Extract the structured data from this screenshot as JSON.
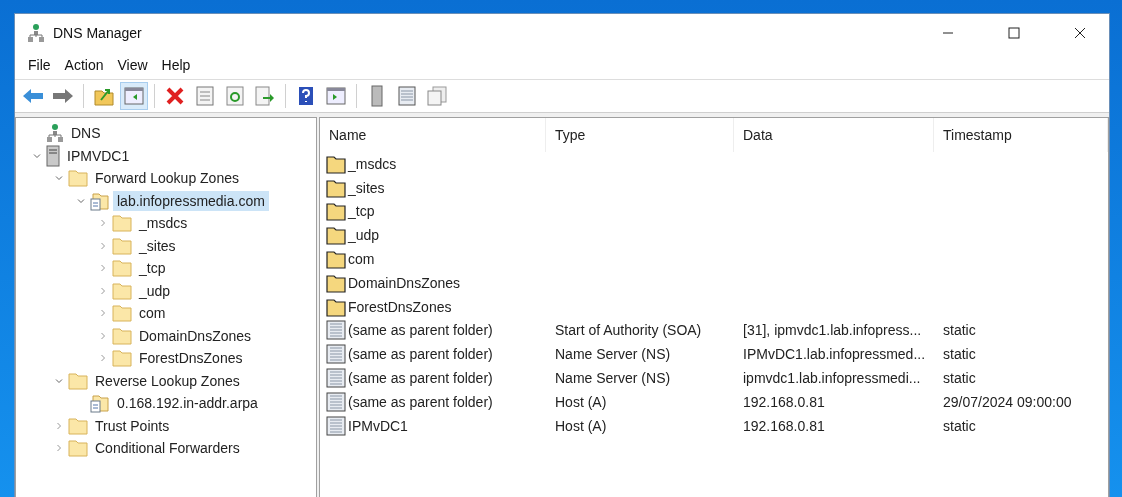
{
  "window": {
    "title": "DNS Manager"
  },
  "menu": [
    "File",
    "Action",
    "View",
    "Help"
  ],
  "toolbar": [
    {
      "kind": "back",
      "pressed": false
    },
    {
      "kind": "forward",
      "pressed": false
    },
    {
      "kind": "separator"
    },
    {
      "kind": "up",
      "pressed": false
    },
    {
      "kind": "console-tree",
      "pressed": true
    },
    {
      "kind": "separator"
    },
    {
      "kind": "delete",
      "pressed": false
    },
    {
      "kind": "properties",
      "pressed": false
    },
    {
      "kind": "refresh",
      "pressed": false
    },
    {
      "kind": "export",
      "pressed": false
    },
    {
      "kind": "separator"
    },
    {
      "kind": "help",
      "pressed": false
    },
    {
      "kind": "action-pane",
      "pressed": false
    },
    {
      "kind": "separator"
    },
    {
      "kind": "server",
      "pressed": false
    },
    {
      "kind": "list",
      "pressed": false
    },
    {
      "kind": "copy",
      "pressed": false
    }
  ],
  "tree": [
    {
      "label": "DNS",
      "kind": "dns",
      "selected": false,
      "children": [
        {
          "label": "IPMVDC1",
          "kind": "server",
          "selected": false,
          "expanded": true,
          "children": [
            {
              "label": "Forward Lookup Zones",
              "kind": "folder",
              "selected": false,
              "expanded": true,
              "children": [
                {
                  "label": "lab.infopressmedia.com",
                  "kind": "zone",
                  "selected": true,
                  "expanded": true,
                  "children": [
                    {
                      "label": "_msdcs",
                      "kind": "folder",
                      "selected": false,
                      "expanded": false
                    },
                    {
                      "label": "_sites",
                      "kind": "folder",
                      "selected": false,
                      "expanded": false
                    },
                    {
                      "label": "_tcp",
                      "kind": "folder",
                      "selected": false,
                      "expanded": false
                    },
                    {
                      "label": "_udp",
                      "kind": "folder",
                      "selected": false,
                      "expanded": false
                    },
                    {
                      "label": "com",
                      "kind": "folder",
                      "selected": false,
                      "expanded": false
                    },
                    {
                      "label": "DomainDnsZones",
                      "kind": "folder",
                      "selected": false,
                      "expanded": false
                    },
                    {
                      "label": "ForestDnsZones",
                      "kind": "folder",
                      "selected": false,
                      "expanded": false
                    }
                  ]
                }
              ]
            },
            {
              "label": "Reverse Lookup Zones",
              "kind": "folder",
              "selected": false,
              "expanded": true,
              "children": [
                {
                  "label": "0.168.192.in-addr.arpa",
                  "kind": "zone",
                  "selected": false
                }
              ]
            },
            {
              "label": "Trust Points",
              "kind": "folder",
              "selected": false,
              "expanded": false
            },
            {
              "label": "Conditional Forwarders",
              "kind": "folder",
              "selected": false,
              "expanded": false
            }
          ]
        }
      ]
    }
  ],
  "table": {
    "columns": [
      "Name",
      "Type",
      "Data",
      "Timestamp"
    ],
    "rows": [
      {
        "kind": "folder",
        "name": "_msdcs"
      },
      {
        "kind": "folder",
        "name": "_sites"
      },
      {
        "kind": "folder",
        "name": "_tcp"
      },
      {
        "kind": "folder",
        "name": "_udp"
      },
      {
        "kind": "folder",
        "name": "com"
      },
      {
        "kind": "folder",
        "name": "DomainDnsZones"
      },
      {
        "kind": "folder",
        "name": "ForestDnsZones"
      },
      {
        "kind": "record",
        "name": "(same as parent folder)",
        "type": "Start of Authority (SOA)",
        "data": "[31], ipmvdc1.lab.infopress...",
        "timestamp": "static"
      },
      {
        "kind": "record",
        "name": "(same as parent folder)",
        "type": "Name Server (NS)",
        "data": "IPMvDC1.lab.infopressmed...",
        "timestamp": "static"
      },
      {
        "kind": "record",
        "name": "(same as parent folder)",
        "type": "Name Server (NS)",
        "data": "ipmvdc1.lab.infopressmedi...",
        "timestamp": "static"
      },
      {
        "kind": "record",
        "name": "(same as parent folder)",
        "type": "Host (A)",
        "data": "192.168.0.81",
        "timestamp": "29/07/2024 09:00:00"
      },
      {
        "kind": "record",
        "name": "IPMvDC1",
        "type": "Host (A)",
        "data": "192.168.0.81",
        "timestamp": "static"
      }
    ]
  }
}
